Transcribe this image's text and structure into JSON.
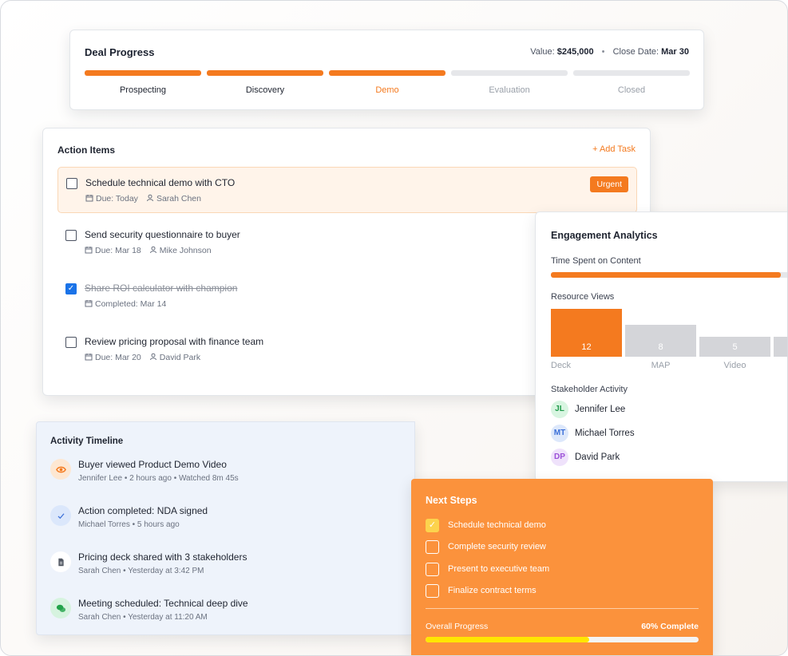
{
  "deal": {
    "title": "Deal Progress",
    "value_label": "Value:",
    "value": "$245,000",
    "close_label": "Close Date:",
    "close_date": "Mar 30",
    "stages": [
      {
        "label": "Prospecting",
        "state": "done"
      },
      {
        "label": "Discovery",
        "state": "done"
      },
      {
        "label": "Demo",
        "state": "current"
      },
      {
        "label": "Evaluation",
        "state": "pending"
      },
      {
        "label": "Closed",
        "state": "pending"
      }
    ]
  },
  "actions": {
    "title": "Action Items",
    "add_label": "+ Add Task",
    "tasks": [
      {
        "name": "Schedule technical demo with CTO",
        "date": "Due: Today",
        "owner": "Sarah Chen",
        "checked": false,
        "badge": "Urgent"
      },
      {
        "name": "Send security questionnaire to buyer",
        "date": "Due: Mar 18",
        "owner": "Mike Johnson",
        "checked": false
      },
      {
        "name": "Share ROI calculator with champion",
        "date": "Completed: Mar 14",
        "owner": "",
        "checked": true
      },
      {
        "name": "Review pricing proposal with finance team",
        "date": "Due: Mar 20",
        "owner": "David Park",
        "checked": false
      }
    ]
  },
  "timeline": {
    "title": "Activity Timeline",
    "items": [
      {
        "title": "Buyer viewed Product Demo Video",
        "meta": "Jennifer Lee • 2 hours ago • Watched 8m 45s",
        "icon": "eye-icon",
        "bg": "#fde7d2",
        "fg": "#f47a1f"
      },
      {
        "title": "Action completed: NDA signed",
        "meta": "Michael Torres • 5 hours ago",
        "icon": "check-icon",
        "bg": "#dbe7fb",
        "fg": "#3b6fd8"
      },
      {
        "title": "Pricing deck shared with 3 stakeholders",
        "meta": "Sarah Chen • Yesterday at 3:42 PM",
        "icon": "document-icon",
        "bg": "#ffffff",
        "fg": "#555b66"
      },
      {
        "title": "Meeting scheduled: Technical deep dive",
        "meta": "Sarah Chen • Yesterday at 11:20 AM",
        "icon": "chat-icon",
        "bg": "#d6f3df",
        "fg": "#22a34a"
      }
    ]
  },
  "engagement": {
    "title": "Engagement Analytics",
    "time_label": "Time Spent on Content",
    "time_fraction": 0.96,
    "views_label": "Resource Views",
    "views": [
      {
        "label": "Deck",
        "value": 12
      },
      {
        "label": "MAP",
        "value": 8
      },
      {
        "label": "Video",
        "value": 5
      },
      {
        "label": "",
        "value": 5
      }
    ],
    "stakeholder_label": "Stakeholder Activity",
    "stakeholders": [
      {
        "initials": "JL",
        "name": "Jennifer Lee",
        "bg": "#d8f5e1",
        "fg": "#1f9a4a"
      },
      {
        "initials": "MT",
        "name": "Michael Torres",
        "bg": "#dde8fb",
        "fg": "#3b6fd8"
      },
      {
        "initials": "DP",
        "name": "David Park",
        "bg": "#efe2fb",
        "fg": "#9b4fd8"
      }
    ]
  },
  "next_steps": {
    "title": "Next Steps",
    "items": [
      {
        "label": "Schedule technical demo",
        "checked": true
      },
      {
        "label": "Complete security review",
        "checked": false
      },
      {
        "label": "Present to executive team",
        "checked": false
      },
      {
        "label": "Finalize contract terms",
        "checked": false
      }
    ],
    "progress_label": "Overall Progress",
    "progress_value": "60% Complete",
    "progress_fraction": 0.6
  },
  "colors": {
    "accent": "#f47a1f",
    "next_bg": "#fb923c",
    "progress_fill": "#ffe600"
  }
}
